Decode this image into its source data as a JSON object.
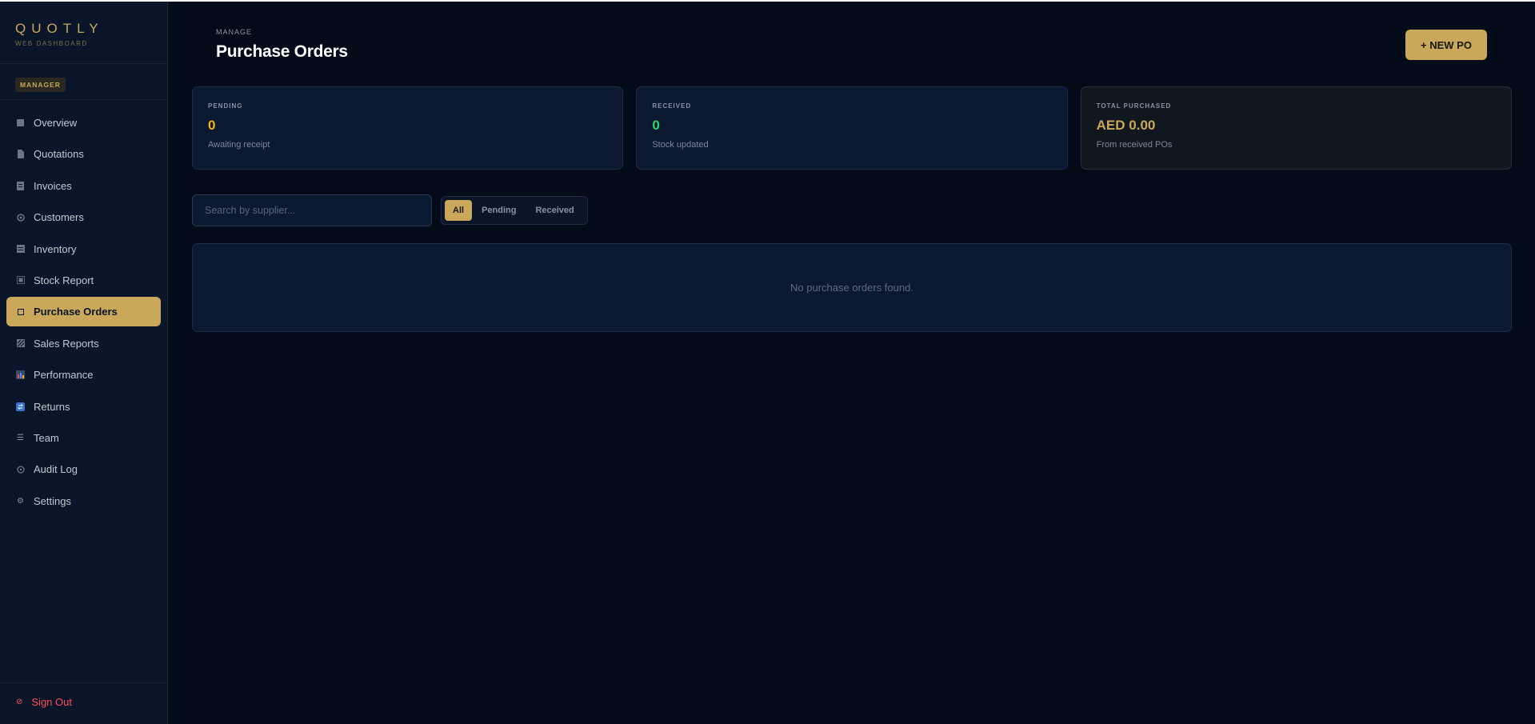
{
  "brand": {
    "name": "QUOTLY",
    "subtitle": "WEB DASHBOARD"
  },
  "role": "MANAGER",
  "nav": [
    {
      "label": "Overview",
      "icon": "overview-icon",
      "active": false
    },
    {
      "label": "Quotations",
      "icon": "quotations-icon",
      "active": false
    },
    {
      "label": "Invoices",
      "icon": "invoices-icon",
      "active": false
    },
    {
      "label": "Customers",
      "icon": "customers-icon",
      "active": false
    },
    {
      "label": "Inventory",
      "icon": "inventory-icon",
      "active": false
    },
    {
      "label": "Stock Report",
      "icon": "stock-report-icon",
      "active": false
    },
    {
      "label": "Purchase Orders",
      "icon": "purchase-orders-icon",
      "active": true
    },
    {
      "label": "Sales Reports",
      "icon": "sales-reports-icon",
      "active": false
    },
    {
      "label": "Performance",
      "icon": "bar-chart-icon",
      "active": false
    },
    {
      "label": "Returns",
      "icon": "returns-icon",
      "active": false
    },
    {
      "label": "Team",
      "icon": "menu-lines-icon",
      "active": false
    },
    {
      "label": "Audit Log",
      "icon": "clock-icon",
      "active": false
    },
    {
      "label": "Settings",
      "icon": "gear-icon",
      "active": false
    }
  ],
  "signout": "Sign Out",
  "header": {
    "eyebrow": "MANAGE",
    "title": "Purchase Orders",
    "new_button": "+ NEW PO"
  },
  "stats": [
    {
      "label": "PENDING",
      "value": "0",
      "sub": "Awaiting receipt",
      "color": "#f5b31b"
    },
    {
      "label": "RECEIVED",
      "value": "0",
      "sub": "Stock updated",
      "color": "#2bd46f"
    },
    {
      "label": "TOTAL PURCHASED",
      "value": "AED 0.00",
      "sub": "From received POs",
      "color": "#c9a85b"
    }
  ],
  "search": {
    "placeholder": "Search by supplier..."
  },
  "filters": [
    {
      "label": "All",
      "active": true
    },
    {
      "label": "Pending",
      "active": false
    },
    {
      "label": "Received",
      "active": false
    }
  ],
  "empty_message": "No purchase orders found.",
  "colors": {
    "accent": "#c9a85b",
    "background": "#040b18",
    "sidebar": "#0a1529",
    "danger": "#ff4f5e"
  }
}
